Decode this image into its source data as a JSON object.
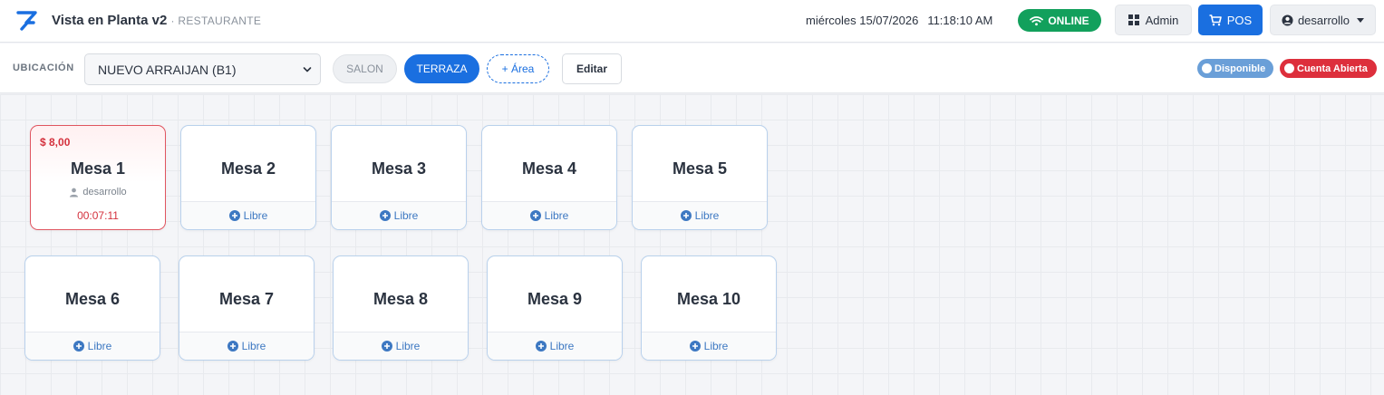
{
  "header": {
    "title": "Vista en Planta v2",
    "subtitle": "· RESTAURANTE",
    "date": "miércoles 15/07/2026",
    "time": "11:18:10 AM",
    "status": "ONLINE",
    "admin_label": "Admin",
    "pos_label": "POS",
    "user_label": "desarrollo"
  },
  "toolbar": {
    "location_label": "UBICACIÓN",
    "location_selected": "NUEVO ARRAIJAN (B1)",
    "areas": [
      {
        "label": "SALON",
        "active": false
      },
      {
        "label": "TERRAZA",
        "active": true
      }
    ],
    "add_area_label": "+ Área",
    "edit_label": "Editar",
    "legend": [
      {
        "label": "Disponible",
        "color": "#6a9fd8"
      },
      {
        "label": "Cuenta Abierta",
        "color": "#dd2f3c"
      }
    ]
  },
  "tables": [
    {
      "name": "Mesa 1",
      "status": "open",
      "amount": "$ 8,00",
      "user": "desarrollo",
      "timer": "00:07:11"
    },
    {
      "name": "Mesa 2",
      "status": "free",
      "footer": "Libre"
    },
    {
      "name": "Mesa 3",
      "status": "free",
      "footer": "Libre"
    },
    {
      "name": "Mesa 4",
      "status": "free",
      "footer": "Libre"
    },
    {
      "name": "Mesa 5",
      "status": "free",
      "footer": "Libre"
    },
    {
      "name": "Mesa 6",
      "status": "free",
      "footer": "Libre"
    },
    {
      "name": "Mesa 7",
      "status": "free",
      "footer": "Libre"
    },
    {
      "name": "Mesa 8",
      "status": "free",
      "footer": "Libre"
    },
    {
      "name": "Mesa 9",
      "status": "free",
      "footer": "Libre"
    },
    {
      "name": "Mesa 10",
      "status": "free",
      "footer": "Libre"
    }
  ],
  "colors": {
    "primary": "#1a6fe0",
    "online": "#12a05c",
    "open_account": "#dd2f3c"
  }
}
